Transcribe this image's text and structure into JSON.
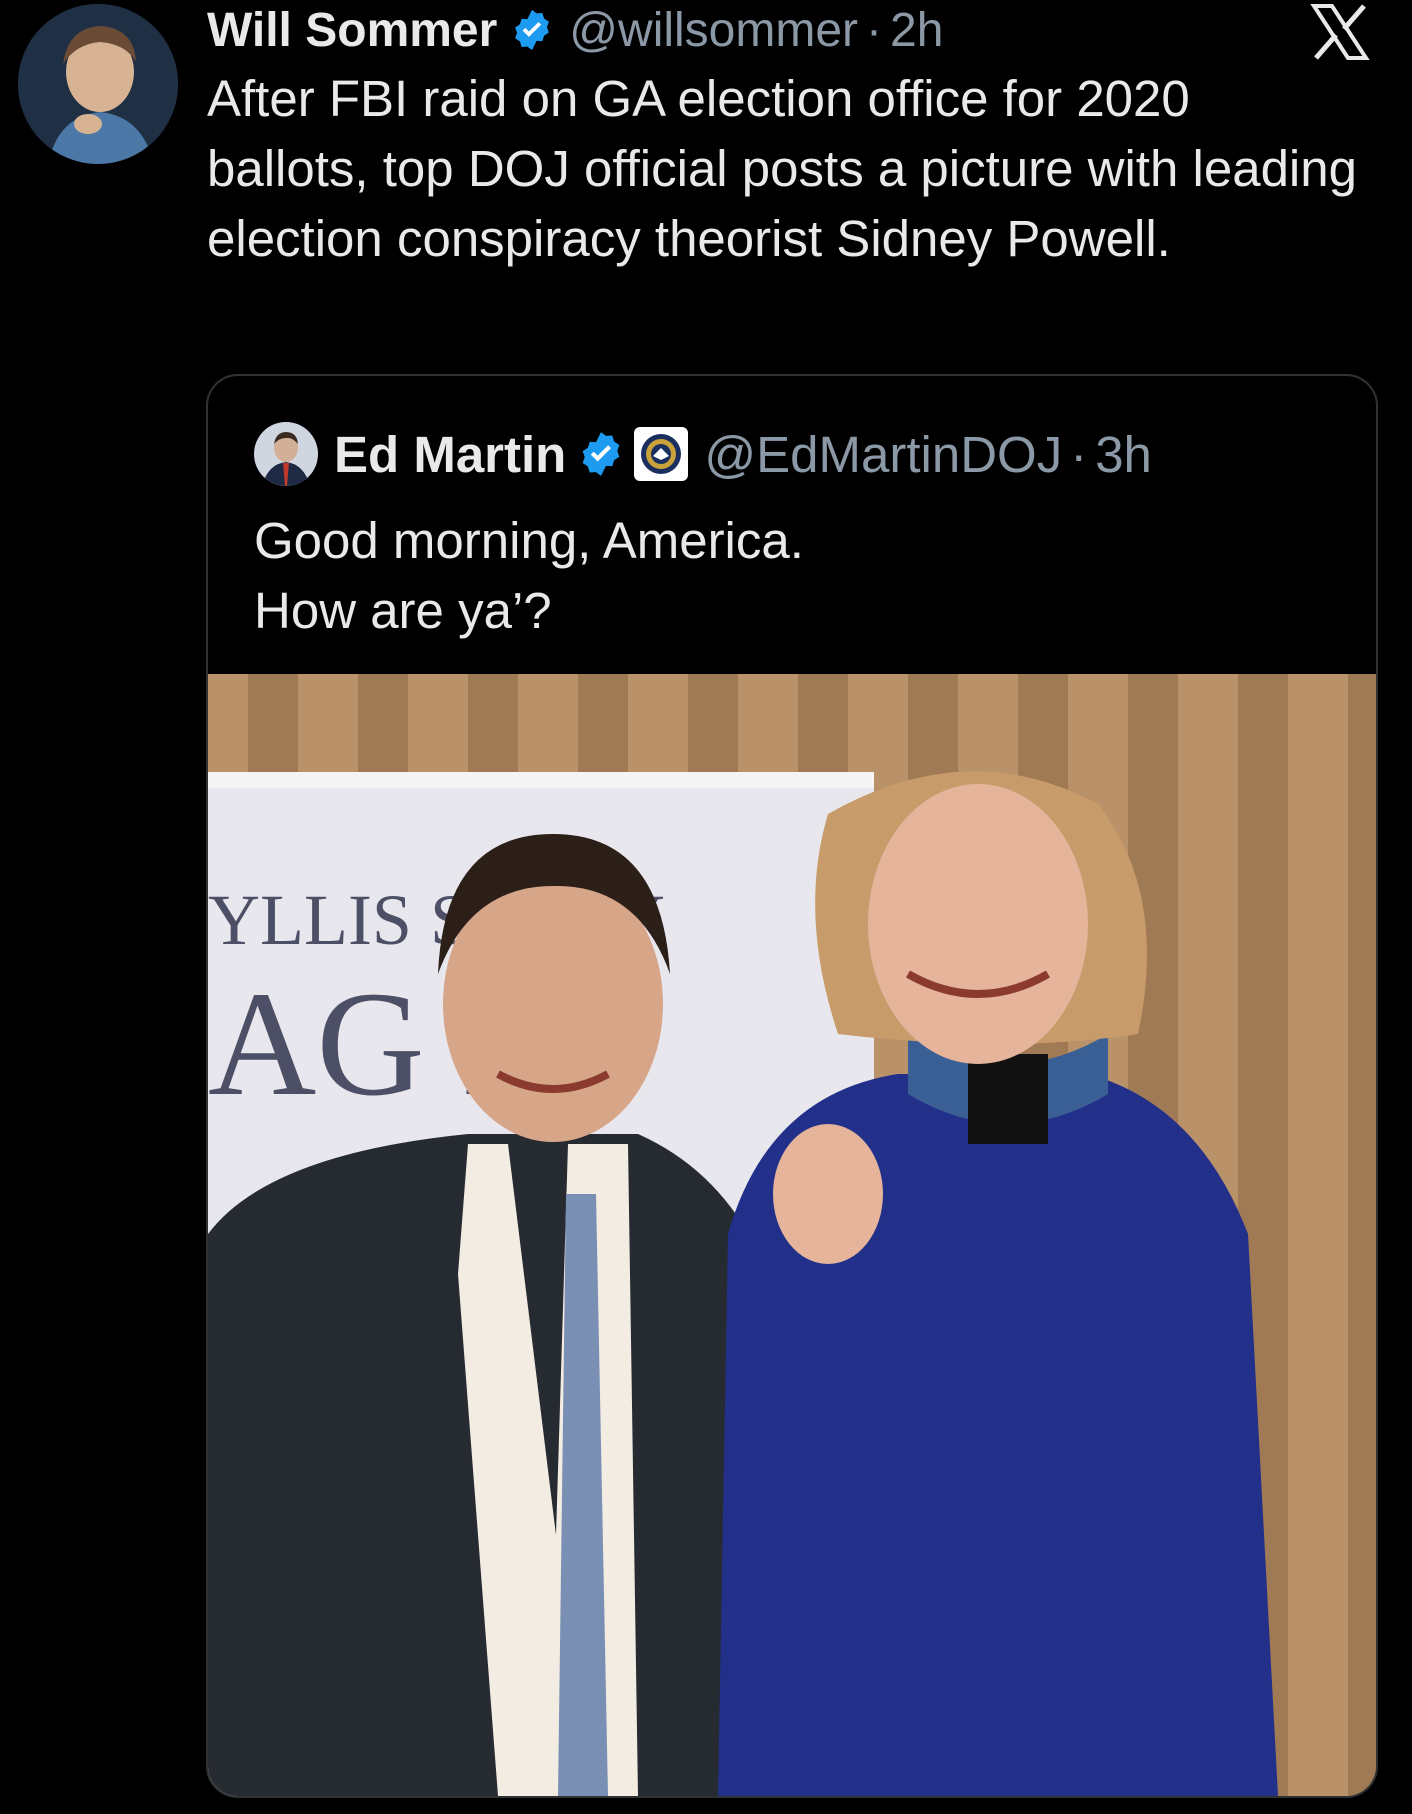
{
  "tweet": {
    "author_name": "Will Sommer",
    "handle": "@willsommer",
    "separator": "·",
    "time": "2h",
    "text": "After FBI raid on GA election office for 2020 ballots, top DOJ official posts a picture with leading election conspiracy theorist Sidney Powell."
  },
  "quote": {
    "author_name": "Ed Martin",
    "handle": "@EdMartinDOJ",
    "separator": "·",
    "time": "3h",
    "text": "Good morning, America.\nHow are ya’?"
  },
  "photo": {
    "banner_line1": "YLLIS S    AFLY",
    "banner_line2": "AG    ES"
  },
  "colors": {
    "background": "#000000",
    "text_primary": "#e7e9ea",
    "text_secondary": "#8b98a5",
    "verified_blue": "#1d9bf0",
    "card_border": "#2f3336"
  },
  "icons": {
    "platform_logo": "x-logo-icon",
    "verified": "verified-badge-icon",
    "affiliation": "doj-seal-icon"
  }
}
